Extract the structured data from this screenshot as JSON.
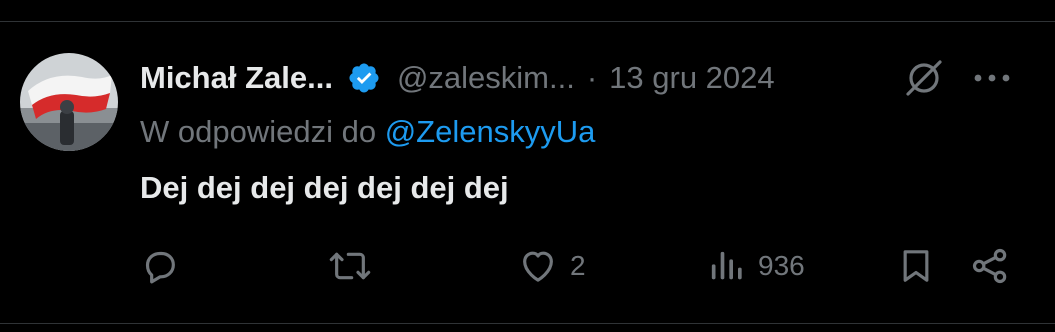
{
  "tweet": {
    "author_name": "Michał Zale...",
    "handle": "@zaleskim...",
    "separator": "·",
    "date": "13 gru 2024",
    "verified": true,
    "reply_prefix": "W odpowiedzi do",
    "reply_to": "@ZelenskyyUa",
    "text": "Dej dej dej dej dej dej dej"
  },
  "actions": {
    "reply_count": "",
    "retweet_count": "",
    "like_count": "2",
    "views_count": "936"
  },
  "icons": {
    "verified": "verified-badge-icon",
    "grok": "grok-icon",
    "more": "more-icon",
    "reply": "reply-icon",
    "retweet": "retweet-icon",
    "like": "heart-icon",
    "views": "views-icon",
    "bookmark": "bookmark-icon",
    "share": "share-icon"
  },
  "colors": {
    "background": "#000000",
    "text_primary": "#e7e9ea",
    "text_secondary": "#71767b",
    "accent": "#1d9bf0",
    "divider": "#2f3336"
  }
}
